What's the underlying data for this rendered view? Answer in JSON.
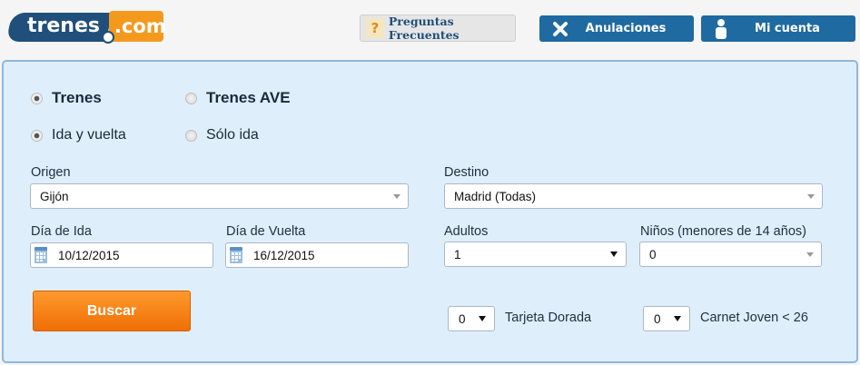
{
  "header": {
    "logo_main": "trenes",
    "logo_suffix": ".com",
    "faq_icon": "?",
    "faq_label": "Preguntas Frecuentes",
    "cancel_label": "Anulaciones",
    "account_label": "Mi cuenta"
  },
  "train_type": {
    "options": [
      "Trenes",
      "Trenes AVE"
    ],
    "selected": "Trenes"
  },
  "trip_type": {
    "options": [
      "Ida y vuelta",
      "Sólo ida"
    ],
    "selected": "Ida y vuelta"
  },
  "form": {
    "origin_label": "Origen",
    "origin_value": "Gijón",
    "destination_label": "Destino",
    "destination_value": "Madrid (Todas)",
    "depart_label": "Día de Ida",
    "depart_value": "10/12/2015",
    "return_label": "Día de Vuelta",
    "return_value": "16/12/2015",
    "adults_label": "Adultos",
    "adults_value": "1",
    "children_label": "Niños (menores de 14 años)",
    "children_value": "0",
    "search_label": "Buscar",
    "golden_card_value": "0",
    "golden_card_label": "Tarjeta Dorada",
    "youth_card_value": "0",
    "youth_card_label": "Carnet Joven < 26"
  },
  "colors": {
    "brand_blue": "#1f4f7a",
    "brand_orange": "#f39a1e",
    "button_blue": "#1f6aa0",
    "search_orange": "#f58413"
  },
  "icons": [
    "question-icon",
    "cancel-x-icon",
    "user-icon",
    "calendar-icon",
    "chevron-down-icon"
  ]
}
